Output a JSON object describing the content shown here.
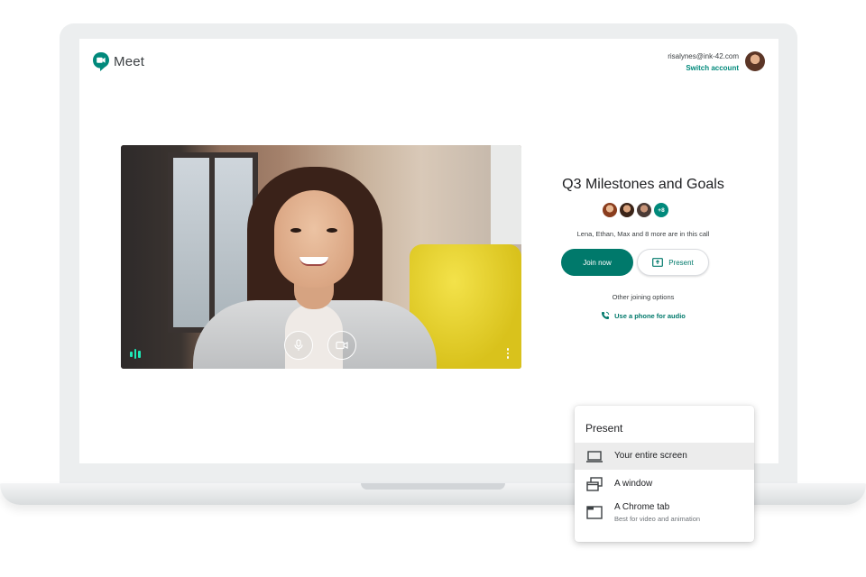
{
  "app": {
    "name": "Meet"
  },
  "account": {
    "email": "risalynes@ink-42.com",
    "switch_label": "Switch account"
  },
  "meeting": {
    "title": "Q3 Milestones and Goals",
    "extra_participants_badge": "+8",
    "in_call_text": "Lena, Ethan, Max and 8 more are in this call",
    "join_label": "Join now",
    "present_label": "Present",
    "other_options_label": "Other joining options",
    "phone_label": "Use a phone for audio"
  },
  "present_menu": {
    "title": "Present",
    "items": [
      {
        "label": "Your entire screen",
        "icon": "monitor-icon",
        "selected": true
      },
      {
        "label": "A window",
        "icon": "window-icon",
        "selected": false
      },
      {
        "label": "A Chrome tab",
        "sublabel": "Best for video and animation",
        "icon": "chrome-tab-icon",
        "selected": false
      }
    ]
  },
  "colors": {
    "accent": "#00796b",
    "accent_light": "#00897b",
    "audio_indicator": "#1de9b6"
  }
}
